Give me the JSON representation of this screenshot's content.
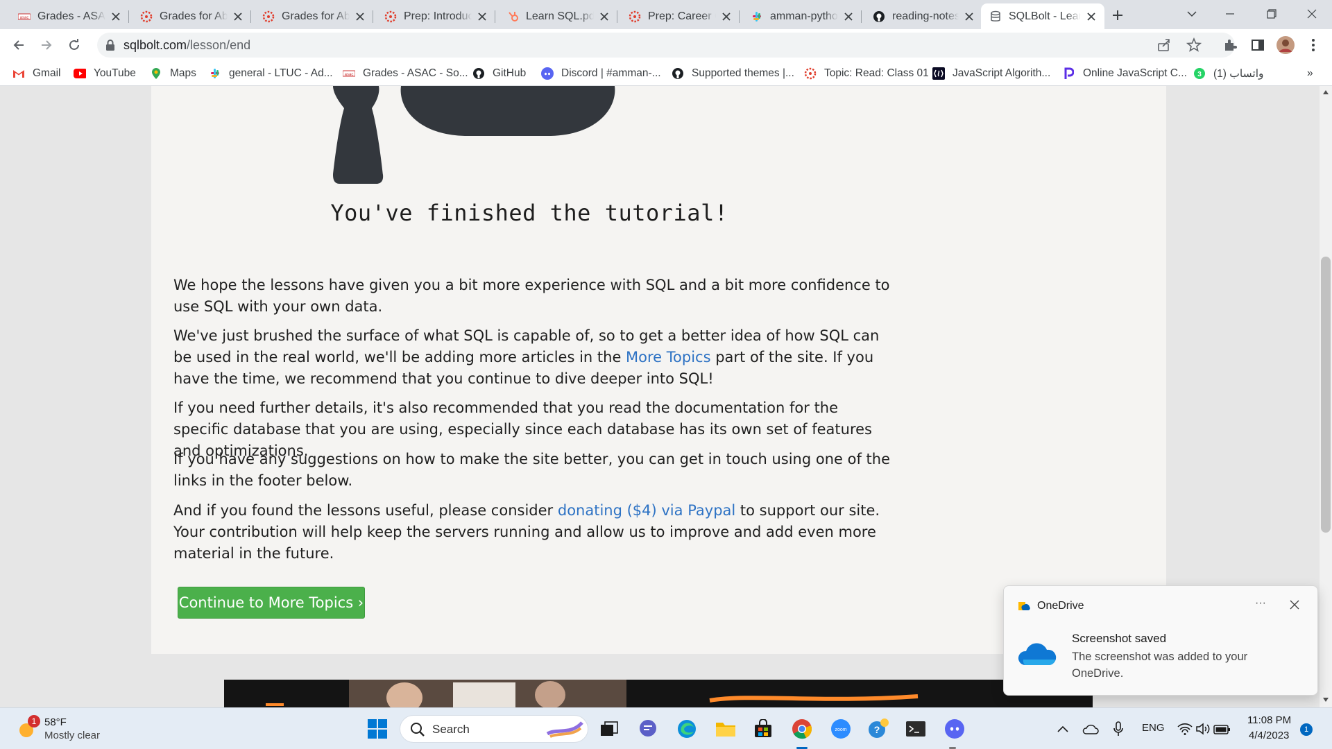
{
  "browser": {
    "tabs": [
      {
        "title": "Grades - ASAC",
        "favicon": "asac-logo-icon"
      },
      {
        "title": "Grades for Abdulhafiz",
        "favicon": "canvas-icon"
      },
      {
        "title": "Grades for Abdulhafiz",
        "favicon": "canvas-icon"
      },
      {
        "title": "Prep: Introduction",
        "favicon": "canvas-icon"
      },
      {
        "title": "Learn SQL.pdf",
        "favicon": "hubspot-icon"
      },
      {
        "title": "Prep: Career Coaching",
        "favicon": "canvas-icon"
      },
      {
        "title": "amman-python",
        "favicon": "slack-icon"
      },
      {
        "title": "reading-notes",
        "favicon": "github-icon"
      },
      {
        "title": "SQLBolt - Learn SQL",
        "favicon": "database-icon",
        "active": true
      }
    ],
    "url_host": "sqlbolt.com",
    "url_path": "/lesson/end",
    "bookmarks": [
      {
        "label": "Gmail",
        "icon": "gmail-icon"
      },
      {
        "label": "YouTube",
        "icon": "youtube-icon"
      },
      {
        "label": "Maps",
        "icon": "maps-icon"
      },
      {
        "label": "general - LTUC - Ad...",
        "icon": "slack-icon"
      },
      {
        "label": "Grades - ASAC - So...",
        "icon": "asac-logo-icon"
      },
      {
        "label": "GitHub",
        "icon": "github-icon"
      },
      {
        "label": "Discord | #amman-...",
        "icon": "discord-icon"
      },
      {
        "label": "Supported themes |...",
        "icon": "github-icon"
      },
      {
        "label": "Topic: Read: Class 01",
        "icon": "canvas-icon"
      },
      {
        "label": "JavaScript Algorith...",
        "icon": "freecodecamp-icon"
      },
      {
        "label": "Online JavaScript C...",
        "icon": "programiz-icon"
      },
      {
        "label": "واتساب (1)",
        "icon": "whatsapp-icon"
      }
    ],
    "more_bookmarks": "»"
  },
  "page": {
    "heading": "You've finished the tutorial!",
    "paragraphs": {
      "p1": "We hope the lessons have given you a bit more experience with SQL and a bit more confidence to use SQL with your own data.",
      "p2_before": "We've just brushed the surface of what SQL is capable of, so to get a better idea of how SQL can be used in the real world, we'll be adding more articles in the ",
      "p2_link": "More Topics",
      "p2_after": " part of the site. If you have the time, we recommend that you continue to dive deeper into SQL!",
      "p3": "If you need further details, it's also recommended that you read the documentation for the specific database that you are using, especially since each database has its own set of features and optimizations.",
      "p4": "If you have any suggestions on how to make the site better, you can get in touch using one of the links in the footer below.",
      "p5_before": "And if you found the lessons useful, please consider ",
      "p5_link": "donating ($4) via Paypal",
      "p5_after": " to support our site. Your contribution will help keep the servers running and allow us to improve and add even more material in the future."
    },
    "continue_button": "Continue to More Topics ›"
  },
  "toast": {
    "app": "OneDrive",
    "more": "···",
    "title": "Screenshot saved",
    "message": "The screenshot was added to your OneDrive."
  },
  "taskbar": {
    "weather_temp": "58°F",
    "weather_desc": "Mostly clear",
    "weather_badge": "1",
    "search_label": "Search",
    "language": "ENG",
    "time": "11:08 PM",
    "date": "4/4/2023",
    "notification_count": "1"
  },
  "colors": {
    "link": "#2d72c4",
    "button_green": "#4bb04b",
    "card_bg": "#f5f4f2"
  }
}
